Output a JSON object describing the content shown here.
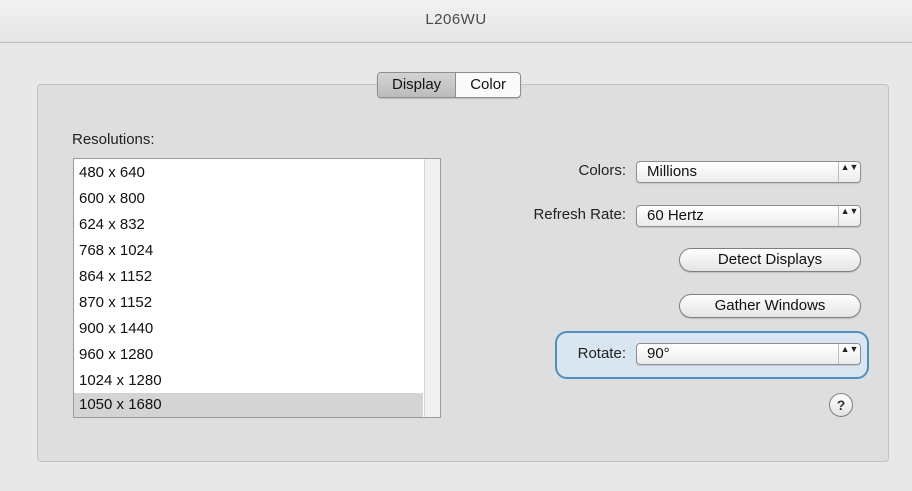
{
  "window": {
    "title": "L206WU"
  },
  "tabs": [
    {
      "label": "Display",
      "active": true
    },
    {
      "label": "Color",
      "active": false
    }
  ],
  "resolutions": {
    "label": "Resolutions:",
    "items": [
      "480 x 640",
      "600 x 800",
      "624 x 832",
      "768 x 1024",
      "864 x 1152",
      "870 x 1152",
      "900 x 1440",
      "960 x 1280",
      "1024 x 1280",
      "1050 x 1680"
    ],
    "selected": "1050 x 1680"
  },
  "colors": {
    "label": "Colors:",
    "value": "Millions"
  },
  "refresh": {
    "label": "Refresh Rate:",
    "value": "60 Hertz"
  },
  "buttons": {
    "detect": "Detect Displays",
    "gather": "Gather Windows"
  },
  "rotate": {
    "label": "Rotate:",
    "value": "90°"
  },
  "help": {
    "glyph": "?"
  },
  "popup_arrows": "▲▼",
  "accent_color": "#4f8fc0"
}
